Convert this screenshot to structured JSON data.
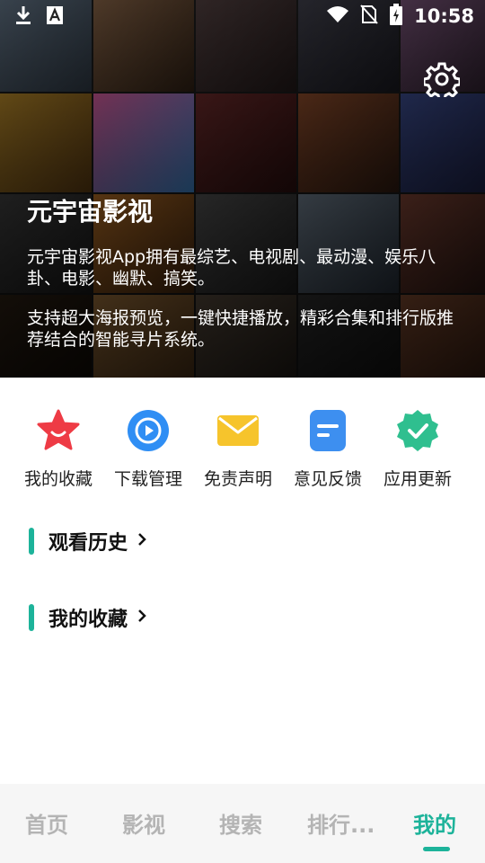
{
  "status_bar": {
    "time": "10:58",
    "icons": [
      "download-icon",
      "a-icon",
      "wifi-icon",
      "no-sim-icon",
      "battery-charging-icon"
    ]
  },
  "hero": {
    "title": "元宇宙影视",
    "description_1": "元宇宙影视App拥有最综艺、电视剧、最动漫、娱乐八卦、电影、幽默、搞笑。",
    "description_2": "支持超大海报预览，一键快捷播放，精彩合集和排行版推荐结合的智能寻片系统。",
    "settings_icon": "gear-icon"
  },
  "actions": [
    {
      "label": "我的收藏",
      "icon": "star-icon",
      "color": "#ee3b45"
    },
    {
      "label": "下载管理",
      "icon": "play-circle-icon",
      "color": "#2f8ef4"
    },
    {
      "label": "免责声明",
      "icon": "envelope-icon",
      "color": "#f6c42c"
    },
    {
      "label": "意见反馈",
      "icon": "document-icon",
      "color": "#3d8ff0"
    },
    {
      "label": "应用更新",
      "icon": "badge-check-icon",
      "color": "#2fbf8f"
    }
  ],
  "sections": {
    "history": "观看历史",
    "favorites": "我的收藏"
  },
  "bottom_nav": {
    "tabs": [
      "首页",
      "影视",
      "搜索",
      "排行...",
      "我的"
    ],
    "active": "我的"
  },
  "colors": {
    "accent": "#1db39a",
    "tab_inactive": "#b4b4b4"
  }
}
